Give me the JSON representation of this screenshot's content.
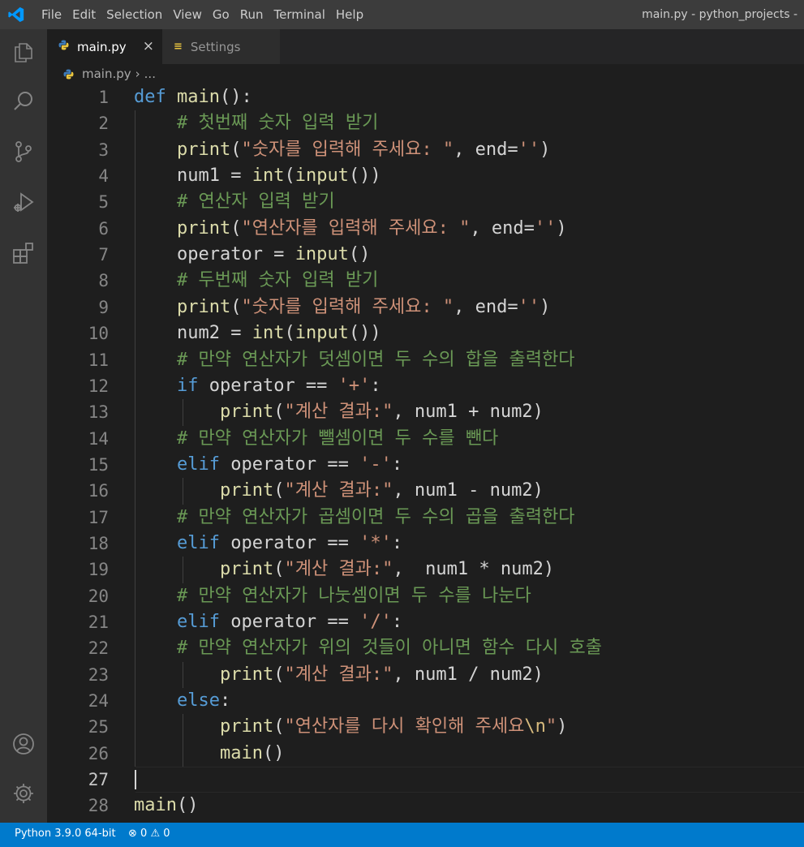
{
  "window_title": "main.py - python_projects -",
  "menu": [
    "File",
    "Edit",
    "Selection",
    "View",
    "Go",
    "Run",
    "Terminal",
    "Help"
  ],
  "activity_bar": [
    "explorer-icon",
    "search-icon",
    "source-control-icon",
    "run-debug-icon",
    "extensions-icon",
    "account-icon",
    "settings-gear-icon"
  ],
  "tabs": [
    {
      "label": "main.py",
      "icon": "python-icon",
      "active": true,
      "close": "×"
    },
    {
      "label": "Settings",
      "icon": "settings-list-icon",
      "active": false,
      "glyph": "≡"
    }
  ],
  "breadcrumb": {
    "file": "main.py",
    "separator": "›",
    "more": "..."
  },
  "colors": {
    "keyword": "#569cd6",
    "function": "#dcdcaa",
    "comment": "#6a9955",
    "string": "#ce9178",
    "escape": "#d7ba7d",
    "text": "#d4d4d4",
    "status_bar": "#007acc"
  },
  "editor": {
    "active_line": 27,
    "lines": [
      {
        "n": "1",
        "tokens": [
          {
            "t": "def",
            "c": "kw"
          },
          {
            "t": " "
          },
          {
            "t": "main",
            "c": "fn"
          },
          {
            "t": "():"
          }
        ]
      },
      {
        "n": "2",
        "tokens": [
          {
            "t": "    "
          },
          {
            "t": "# 첫번째 숫자 입력 받기",
            "c": "cm"
          }
        ]
      },
      {
        "n": "3",
        "tokens": [
          {
            "t": "    "
          },
          {
            "t": "print",
            "c": "fn"
          },
          {
            "t": "("
          },
          {
            "t": "\"숫자를 입력해 주세요: \"",
            "c": "st"
          },
          {
            "t": ", end="
          },
          {
            "t": "''",
            "c": "st"
          },
          {
            "t": ")"
          }
        ]
      },
      {
        "n": "4",
        "tokens": [
          {
            "t": "    num1 = "
          },
          {
            "t": "int",
            "c": "fn"
          },
          {
            "t": "("
          },
          {
            "t": "input",
            "c": "fn"
          },
          {
            "t": "())"
          }
        ]
      },
      {
        "n": "5",
        "tokens": [
          {
            "t": "    "
          },
          {
            "t": "# 연산자 입력 받기",
            "c": "cm"
          }
        ]
      },
      {
        "n": "6",
        "tokens": [
          {
            "t": "    "
          },
          {
            "t": "print",
            "c": "fn"
          },
          {
            "t": "("
          },
          {
            "t": "\"연산자를 입력해 주세요: \"",
            "c": "st"
          },
          {
            "t": ", end="
          },
          {
            "t": "''",
            "c": "st"
          },
          {
            "t": ")"
          }
        ]
      },
      {
        "n": "7",
        "tokens": [
          {
            "t": "    operator = "
          },
          {
            "t": "input",
            "c": "fn"
          },
          {
            "t": "()"
          }
        ]
      },
      {
        "n": "8",
        "tokens": [
          {
            "t": "    "
          },
          {
            "t": "# 두번째 숫자 입력 받기",
            "c": "cm"
          }
        ]
      },
      {
        "n": "9",
        "tokens": [
          {
            "t": "    "
          },
          {
            "t": "print",
            "c": "fn"
          },
          {
            "t": "("
          },
          {
            "t": "\"숫자를 입력해 주세요: \"",
            "c": "st"
          },
          {
            "t": ", end="
          },
          {
            "t": "''",
            "c": "st"
          },
          {
            "t": ")"
          }
        ]
      },
      {
        "n": "10",
        "tokens": [
          {
            "t": "    num2 = "
          },
          {
            "t": "int",
            "c": "fn"
          },
          {
            "t": "("
          },
          {
            "t": "input",
            "c": "fn"
          },
          {
            "t": "())"
          }
        ]
      },
      {
        "n": "11",
        "tokens": [
          {
            "t": "    "
          },
          {
            "t": "# 만약 연산자가 덧셈이면 두 수의 합을 출력한다",
            "c": "cm"
          }
        ]
      },
      {
        "n": "12",
        "tokens": [
          {
            "t": "    "
          },
          {
            "t": "if",
            "c": "kw"
          },
          {
            "t": " operator == "
          },
          {
            "t": "'+'",
            "c": "st"
          },
          {
            "t": ":"
          }
        ]
      },
      {
        "n": "13",
        "tokens": [
          {
            "t": "        "
          },
          {
            "t": "print",
            "c": "fn"
          },
          {
            "t": "("
          },
          {
            "t": "\"계산 결과:\"",
            "c": "st"
          },
          {
            "t": ", num1 + num2)"
          }
        ]
      },
      {
        "n": "14",
        "tokens": [
          {
            "t": "    "
          },
          {
            "t": "# 만약 연산자가 뺄셈이면 두 수를 뺀다",
            "c": "cm"
          }
        ]
      },
      {
        "n": "15",
        "tokens": [
          {
            "t": "    "
          },
          {
            "t": "elif",
            "c": "kw"
          },
          {
            "t": " operator == "
          },
          {
            "t": "'-'",
            "c": "st"
          },
          {
            "t": ":"
          }
        ]
      },
      {
        "n": "16",
        "tokens": [
          {
            "t": "        "
          },
          {
            "t": "print",
            "c": "fn"
          },
          {
            "t": "("
          },
          {
            "t": "\"계산 결과:\"",
            "c": "st"
          },
          {
            "t": ", num1 - num2)"
          }
        ]
      },
      {
        "n": "17",
        "tokens": [
          {
            "t": "    "
          },
          {
            "t": "# 만약 연산자가 곱셈이면 두 수의 곱을 출력한다",
            "c": "cm"
          }
        ]
      },
      {
        "n": "18",
        "tokens": [
          {
            "t": "    "
          },
          {
            "t": "elif",
            "c": "kw"
          },
          {
            "t": " operator == "
          },
          {
            "t": "'*'",
            "c": "st"
          },
          {
            "t": ":"
          }
        ]
      },
      {
        "n": "19",
        "tokens": [
          {
            "t": "        "
          },
          {
            "t": "print",
            "c": "fn"
          },
          {
            "t": "("
          },
          {
            "t": "\"계산 결과:\"",
            "c": "st"
          },
          {
            "t": ",  num1 * num2)"
          }
        ]
      },
      {
        "n": "20",
        "tokens": [
          {
            "t": "    "
          },
          {
            "t": "# 만약 연산자가 나눗셈이면 두 수를 나눈다",
            "c": "cm"
          }
        ]
      },
      {
        "n": "21",
        "tokens": [
          {
            "t": "    "
          },
          {
            "t": "elif",
            "c": "kw"
          },
          {
            "t": " operator == "
          },
          {
            "t": "'/'",
            "c": "st"
          },
          {
            "t": ":"
          }
        ]
      },
      {
        "n": "22",
        "tokens": [
          {
            "t": "    "
          },
          {
            "t": "# 만약 연산자가 위의 것들이 아니면 함수 다시 호출",
            "c": "cm"
          }
        ]
      },
      {
        "n": "23",
        "tokens": [
          {
            "t": "        "
          },
          {
            "t": "print",
            "c": "fn"
          },
          {
            "t": "("
          },
          {
            "t": "\"계산 결과:\"",
            "c": "st"
          },
          {
            "t": ", num1 / num2)"
          }
        ]
      },
      {
        "n": "24",
        "tokens": [
          {
            "t": "    "
          },
          {
            "t": "else",
            "c": "kw"
          },
          {
            "t": ":"
          }
        ]
      },
      {
        "n": "25",
        "tokens": [
          {
            "t": "        "
          },
          {
            "t": "print",
            "c": "fn"
          },
          {
            "t": "("
          },
          {
            "t": "\"연산자를 다시 확인해 주세요",
            "c": "st"
          },
          {
            "t": "\\n",
            "c": "esc"
          },
          {
            "t": "\"",
            "c": "st"
          },
          {
            "t": ")"
          }
        ]
      },
      {
        "n": "26",
        "tokens": [
          {
            "t": "        "
          },
          {
            "t": "main",
            "c": "fn"
          },
          {
            "t": "()"
          }
        ]
      },
      {
        "n": "27",
        "tokens": []
      },
      {
        "n": "28",
        "tokens": [
          {
            "t": "main",
            "c": "fn"
          },
          {
            "t": "()"
          }
        ]
      }
    ]
  },
  "status": {
    "interpreter": "Python 3.9.0 64-bit",
    "errors": "0",
    "warnings": "0"
  }
}
